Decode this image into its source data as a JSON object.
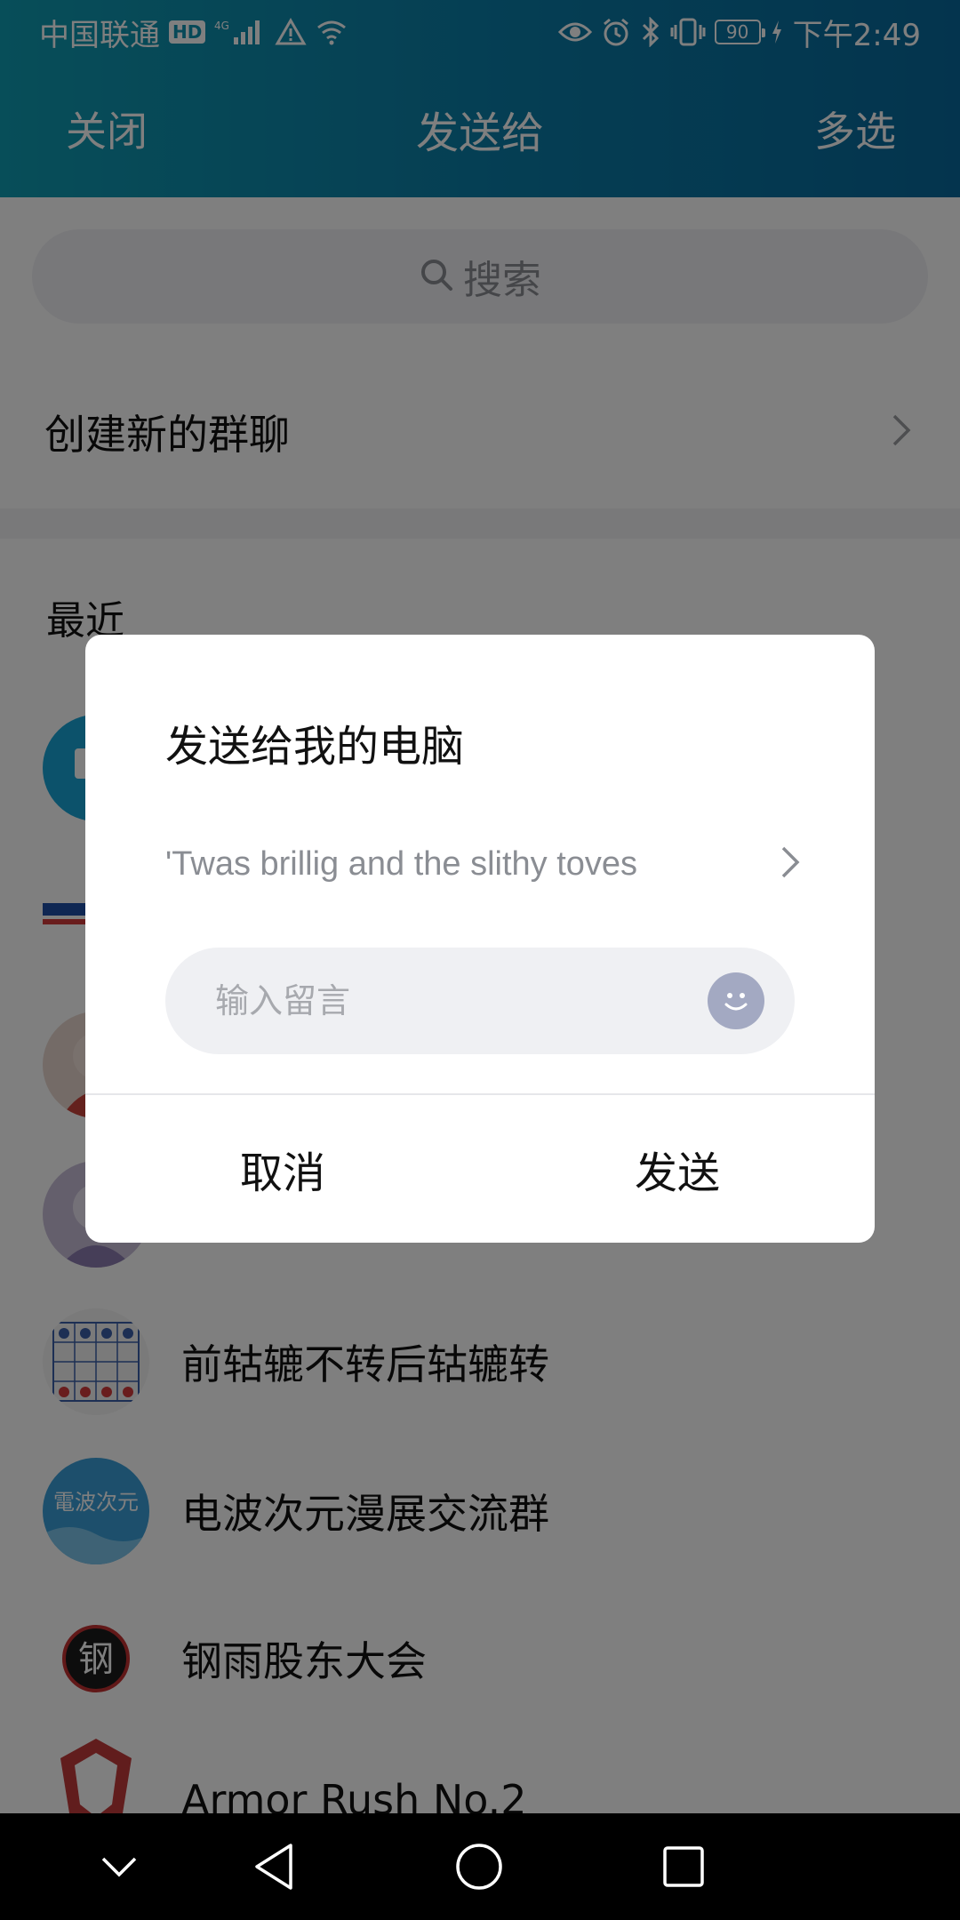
{
  "status_bar": {
    "carrier": "中国联通",
    "hd": "HD",
    "network": "4G",
    "battery": "90",
    "time": "下午2:49"
  },
  "nav": {
    "left": "关闭",
    "title": "发送给",
    "right": "多选"
  },
  "search": {
    "label": "搜索"
  },
  "create_group": {
    "label": "创建新的群聊"
  },
  "recent": {
    "title": "最近",
    "items": [
      {
        "name": "前轱辘不转后轱辘转",
        "avatar": "chess-board"
      },
      {
        "name": "电波次元漫展交流群",
        "avatar": "dianbo-logo",
        "avatar_text": "電波次元"
      },
      {
        "name": "钢雨股东大会",
        "avatar": "gangyu-logo",
        "avatar_text": "钢"
      },
      {
        "name": "Armor Rush No.2",
        "avatar": "armor-logo"
      }
    ]
  },
  "dialog": {
    "title": "发送给我的电脑",
    "preview": "'Twas brillig and the slithy toves",
    "message_placeholder": "输入留言",
    "cancel": "取消",
    "send": "发送"
  },
  "colors": {
    "header_start": "#0f9cb2",
    "header_end": "#08699c",
    "overlay": "rgba(0,0,0,0.5)"
  }
}
